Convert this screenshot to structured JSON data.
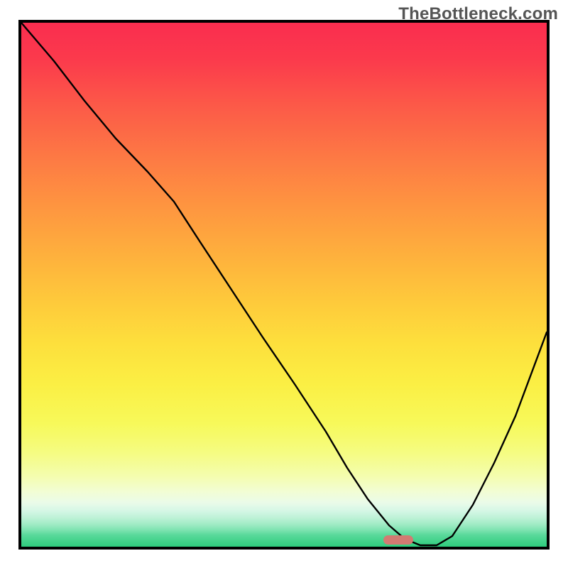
{
  "watermark": "TheBottleneck.com",
  "chart_data": {
    "type": "line",
    "title": "",
    "xlabel": "",
    "ylabel": "",
    "xlim": [
      0,
      100
    ],
    "ylim": [
      0,
      100
    ],
    "grid": false,
    "legend": false,
    "series": [
      {
        "name": "bottleneck-curve",
        "x": [
          0,
          6,
          12,
          18,
          24,
          29,
          34,
          40,
          46,
          52,
          58,
          62,
          66,
          70,
          73,
          76,
          79,
          82,
          86,
          90,
          94,
          100
        ],
        "y": [
          100,
          93,
          85,
          78,
          72,
          66,
          58,
          49,
          40,
          31,
          22,
          15,
          9,
          4,
          1,
          0,
          0,
          2,
          8,
          16,
          25,
          41
        ]
      }
    ],
    "highlight_marker": {
      "x_center": 72,
      "color": "#d37a72",
      "description": "optimal-zone-indicator"
    },
    "background_gradient": {
      "orientation": "vertical",
      "top_color": "#fa2d4f",
      "bottom_color": "#2ecc7d",
      "meaning": "severity scale (red = high bottleneck, green = balanced)"
    }
  }
}
